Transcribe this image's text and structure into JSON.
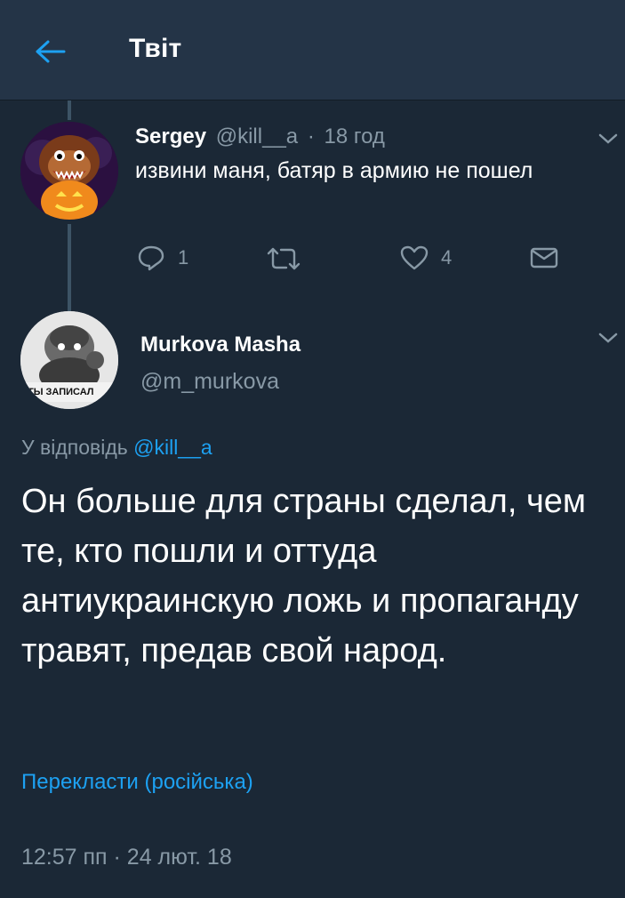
{
  "header": {
    "title": "Твіт"
  },
  "parent_tweet": {
    "author_name": "Sergey",
    "author_handle": "@kill__a",
    "time_separator": "·",
    "time_ago": "18 год",
    "text": "извини маня, батяр в армию не пошел",
    "actions": {
      "reply_count": "1",
      "retweet_count": "",
      "like_count": "4"
    }
  },
  "main_tweet": {
    "author_name": "Murkova Masha",
    "author_handle": "@m_murkova",
    "avatar_caption": "ТЫ ЗАПИСАЛ",
    "reply_prefix": "У відповідь",
    "reply_to": "@kill__a",
    "text": "Он больше для страны сделал, чем те, кто пошли и оттуда антиукраинскую ложь и пропаганду травят, предав свой народ.",
    "translate_label": "Перекласти (російська)",
    "timestamp": "12:57 пп · 24 лют. 18"
  },
  "colors": {
    "background": "#1b2836",
    "header": "#243447",
    "accent": "#1da1f2",
    "muted": "#8899a6"
  }
}
